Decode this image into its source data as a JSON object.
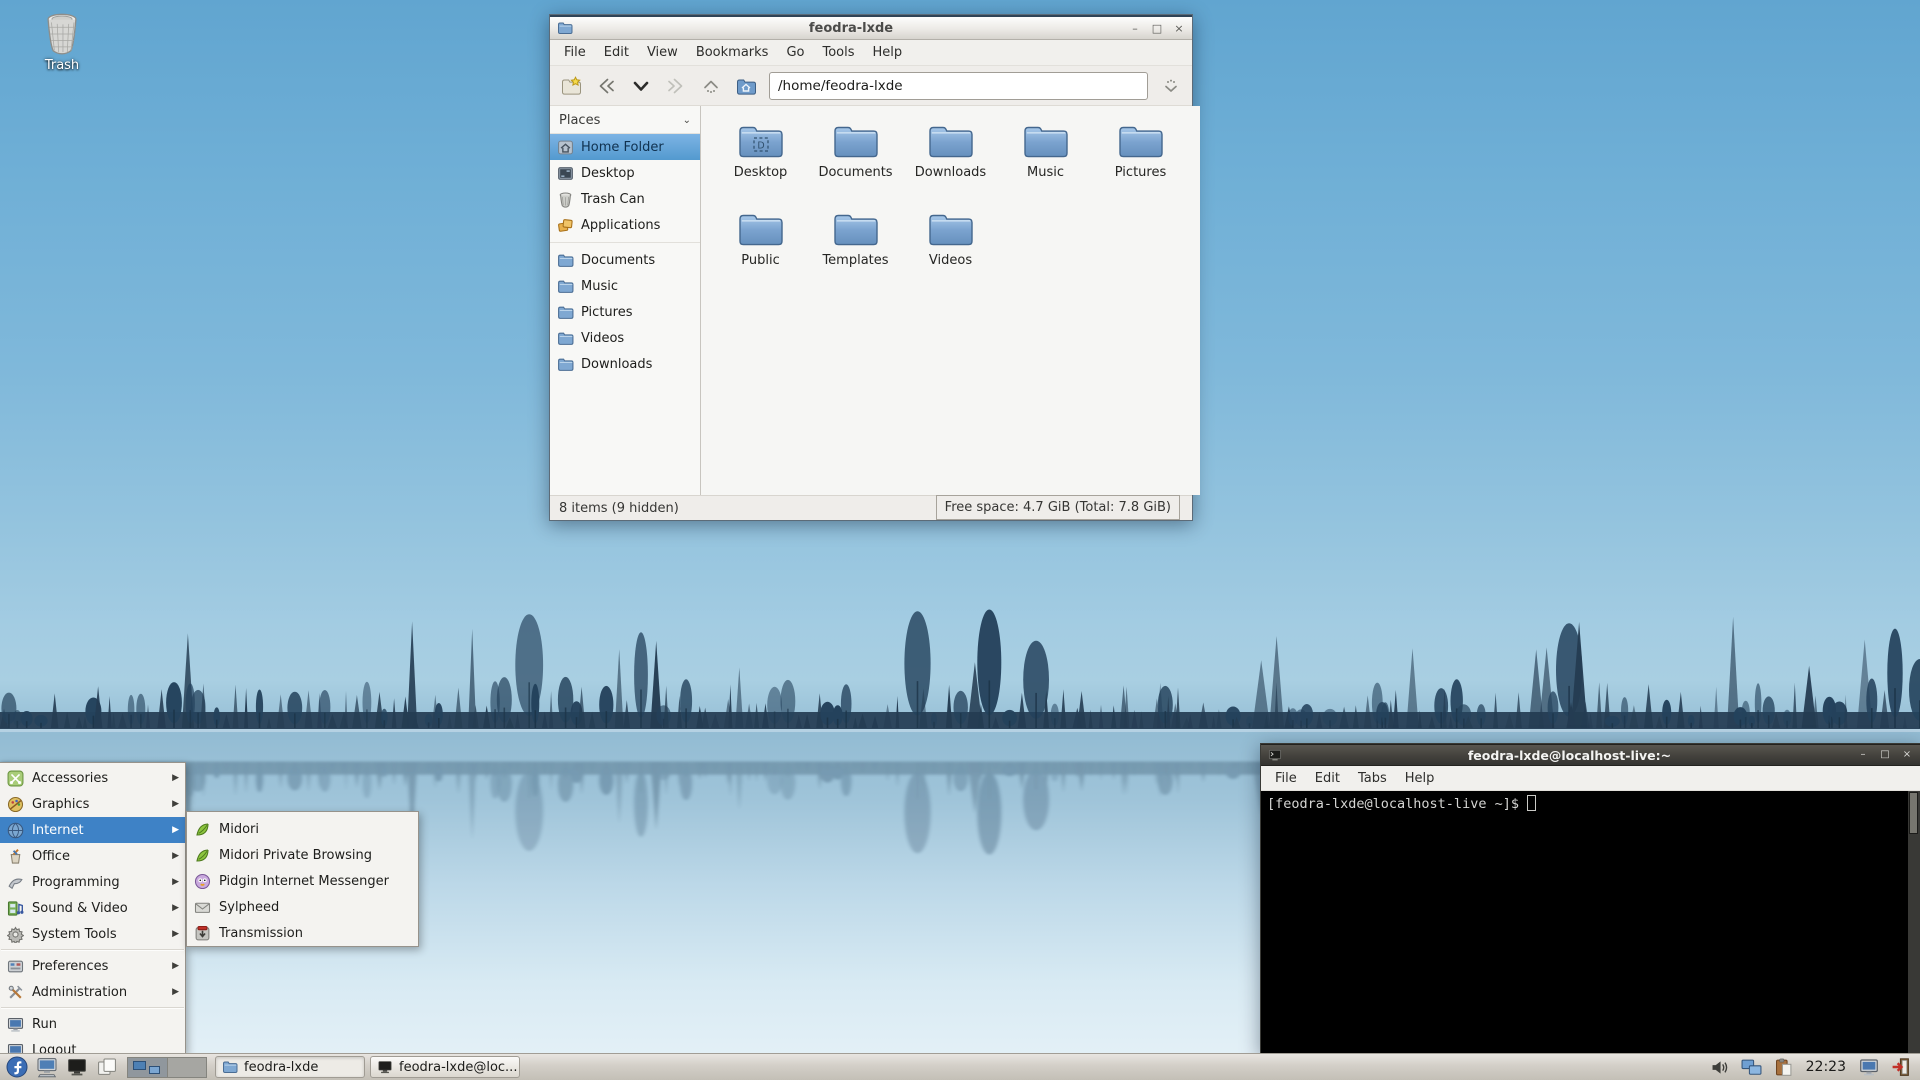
{
  "colors": {
    "selection_blue": "#3e82c6",
    "sidebar_selection": "#5a9ed2",
    "sky_top": "#61a5d0",
    "tree_silhouette": "#243c52",
    "terminal_bg": "#000000",
    "terminal_fg": "#d5d5d3",
    "taskbar_bg": "#d3cfc8",
    "folder_blue": "#7ba3cf"
  },
  "desktop": {
    "trash_label": "Trash"
  },
  "chrome": {
    "minimize": "–",
    "maximize": "□",
    "close": "×"
  },
  "fm": {
    "title": "feodra-lxde",
    "window_icon": "folder-icon",
    "menu": [
      "File",
      "Edit",
      "View",
      "Bookmarks",
      "Go",
      "Tools",
      "Help"
    ],
    "toolbar_icons": [
      "new-tab-icon",
      "back-icon",
      "history-dropdown-icon",
      "forward-icon",
      "up-icon",
      "home-icon"
    ],
    "path": "/home/feodra-lxde",
    "go_icon": "go-jump-icon",
    "places_header": "Places",
    "places": [
      {
        "icon": "home-icon",
        "label": "Home Folder",
        "selected": true
      },
      {
        "icon": "desktop-icon",
        "label": "Desktop"
      },
      {
        "icon": "trash-icon",
        "label": "Trash Can"
      },
      {
        "icon": "applications-icon",
        "label": "Applications"
      },
      {
        "icon": "folder-icon",
        "label": "Documents"
      },
      {
        "icon": "folder-icon",
        "label": "Music"
      },
      {
        "icon": "folder-icon",
        "label": "Pictures"
      },
      {
        "icon": "folder-icon",
        "label": "Videos"
      },
      {
        "icon": "folder-icon",
        "label": "Downloads"
      }
    ],
    "folders": [
      "Desktop",
      "Documents",
      "Downloads",
      "Music",
      "Pictures",
      "Public",
      "Templates",
      "Videos"
    ],
    "status_left": "8 items (9 hidden)",
    "status_right": "Free space: 4.7 GiB (Total: 7.8 GiB)"
  },
  "terminal": {
    "title": "feodra-lxde@localhost-live:~",
    "window_icon": "terminal-icon",
    "menu": [
      "File",
      "Edit",
      "Tabs",
      "Help"
    ],
    "prompt": "[feodra-lxde@localhost-live ~]$"
  },
  "app_menu": {
    "items": [
      {
        "icon": "accessories-icon",
        "label": "Accessories",
        "arrow": "▶"
      },
      {
        "icon": "graphics-icon",
        "label": "Graphics",
        "arrow": "▶"
      },
      {
        "icon": "internet-icon",
        "label": "Internet",
        "arrow": "▶"
      },
      {
        "icon": "office-icon",
        "label": "Office",
        "arrow": "▶"
      },
      {
        "icon": "programming-icon",
        "label": "Programming",
        "arrow": "▶"
      },
      {
        "icon": "sound-video-icon",
        "label": "Sound & Video",
        "arrow": "▶"
      },
      {
        "icon": "system-tools-icon",
        "label": "System Tools",
        "arrow": "▶"
      },
      {
        "icon": "preferences-icon",
        "label": "Preferences",
        "arrow": "▶"
      },
      {
        "icon": "administration-icon",
        "label": "Administration",
        "arrow": "▶"
      },
      {
        "icon": "run-icon",
        "label": "Run",
        "arrow": ""
      },
      {
        "icon": "logout-icon",
        "label": "Logout",
        "arrow": ""
      }
    ],
    "highlighted": "Internet",
    "submenu": [
      {
        "icon": "midori-icon",
        "label": "Midori"
      },
      {
        "icon": "midori-icon",
        "label": "Midori Private Browsing"
      },
      {
        "icon": "pidgin-icon",
        "label": "Pidgin Internet Messenger"
      },
      {
        "icon": "sylpheed-icon",
        "label": "Sylpheed"
      },
      {
        "icon": "transmission-icon",
        "label": "Transmission"
      }
    ]
  },
  "taskbar": {
    "start_icon": "fedora-logo-icon",
    "launchers": [
      "pcmanfm-desktop-icon",
      "terminal-dark-icon",
      "iconify-windows-icon"
    ],
    "pager_desktops": 2,
    "tasks": [
      {
        "icon": "folder-icon",
        "label": "feodra-lxde",
        "active": true
      },
      {
        "icon": "terminal-dark-icon",
        "label": "feodra-lxde@loc...",
        "active": false
      }
    ],
    "tray_icons": [
      "volume-icon",
      "network-icon",
      "clipboard-icon"
    ],
    "clock": "22:23",
    "tray_icons_right": [
      "screensaver-icon",
      "logout-door-icon"
    ]
  }
}
